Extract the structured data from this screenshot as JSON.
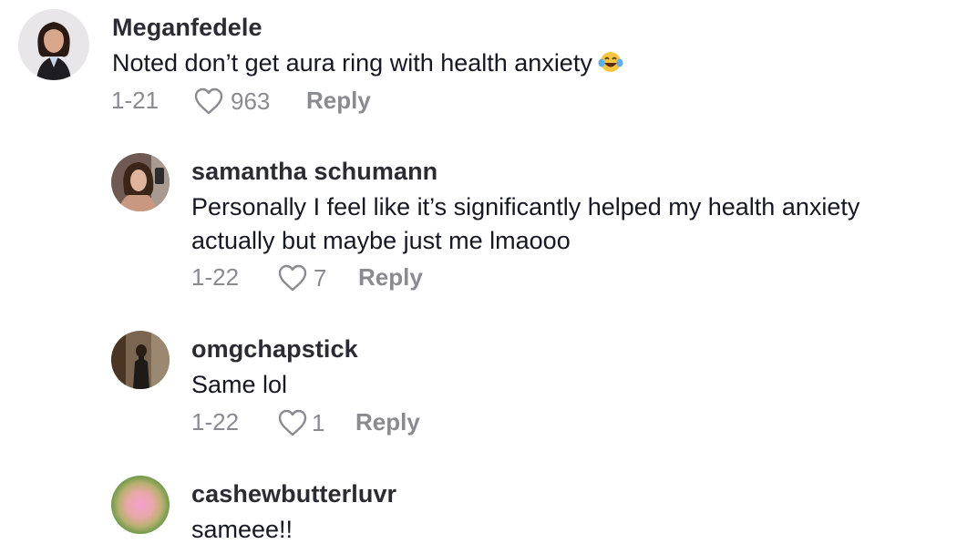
{
  "comments": [
    {
      "username": "Meganfedele",
      "text": "Noted don’t get aura ring with health anxiety",
      "emoji": "laughing-tears-emoji",
      "date": "1-21",
      "likes": "963",
      "reply_label": "Reply"
    },
    {
      "username": "samantha schumann",
      "text_line1": "Personally I feel like it’s significantly helped my health anxiety",
      "text_line2": "actually but maybe just me lmaooo",
      "date": "1-22",
      "likes": "7",
      "reply_label": "Reply"
    },
    {
      "username": "omgchapstick",
      "text": "Same lol",
      "date": "1-22",
      "likes": "1",
      "reply_label": "Reply"
    },
    {
      "username": "cashewbutterluvr",
      "text": "sameee!!"
    }
  ],
  "colors": {
    "text": "#161823",
    "username": "#2a2b33",
    "meta": "#8a8b91",
    "gradient_avatar_center": "#f0a4c8",
    "gradient_avatar_edge": "#7fa05a"
  }
}
